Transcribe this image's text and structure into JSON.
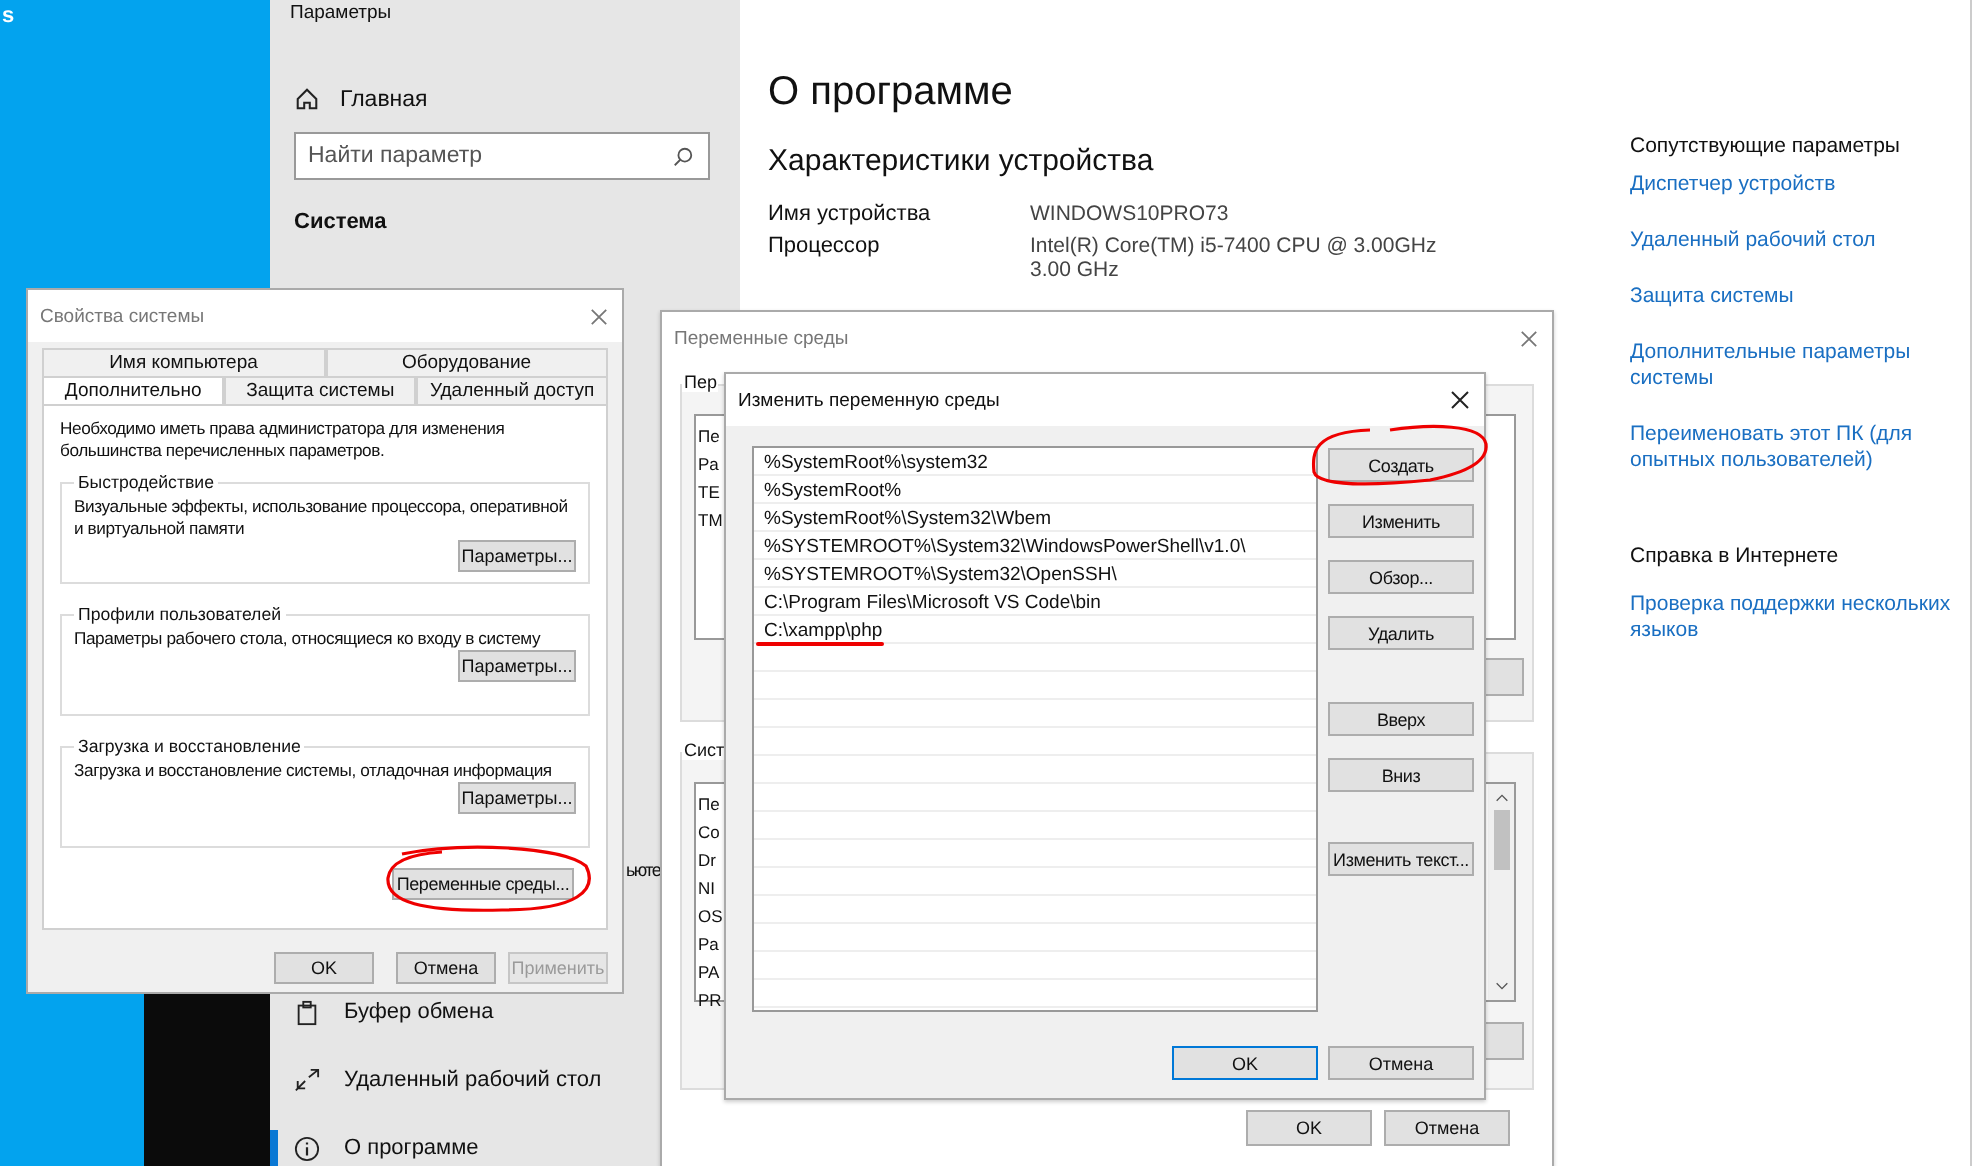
{
  "desktop": {
    "edge_text": "s"
  },
  "settings": {
    "title": "Параметры",
    "home": "Главная",
    "search": {
      "placeholder": "Найти параметр"
    },
    "section": "Система",
    "nav_peek": "ьюте",
    "nav": [
      {
        "label": "Буфер обмена",
        "kind": "clipboard",
        "selected": false
      },
      {
        "label": "Удаленный рабочий стол",
        "kind": "remote",
        "selected": false
      },
      {
        "label": "О программе",
        "kind": "info",
        "selected": true
      }
    ],
    "heading": "О программе",
    "subheading": "Характеристики устройства",
    "specs": [
      {
        "label": "Имя устройства",
        "lines": [
          "WINDOWS10PRO73"
        ]
      },
      {
        "label": "Процессор",
        "lines": [
          "Intel(R) Core(TM) i5-7400 CPU @ 3.00GHz",
          "3.00 GHz"
        ]
      }
    ],
    "related": {
      "title": "Сопутствующие параметры",
      "links": [
        {
          "lines": [
            "Диспетчер устройств"
          ]
        },
        {
          "lines": [
            "Удаленный рабочий стол"
          ]
        },
        {
          "lines": [
            "Защита системы"
          ]
        },
        {
          "lines": [
            "Дополнительные параметры",
            "системы"
          ]
        },
        {
          "lines": [
            "Переименовать этот ПК (для",
            "опытных пользователей)"
          ]
        }
      ]
    },
    "help": {
      "title": "Справка в Интернете",
      "links": [
        {
          "lines": [
            "Проверка поддержки нескольких",
            "языков"
          ]
        }
      ]
    }
  },
  "sysprops": {
    "title": "Свойства системы",
    "tab_rows": [
      [
        {
          "label": "Имя компьютера",
          "selected": false
        },
        {
          "label": "Оборудование",
          "selected": false
        }
      ],
      [
        {
          "label": "Дополнительно",
          "selected": true
        },
        {
          "label": "Защита системы",
          "selected": false
        },
        {
          "label": "Удаленный доступ",
          "selected": false
        }
      ]
    ],
    "note": "Необходимо иметь права администратора для изменения большинства перечисленных параметров.",
    "groups": [
      {
        "title": "Быстродействие",
        "text": "Визуальные эффекты, использование процессора, оперативной и виртуальной памяти",
        "button": "Параметры..."
      },
      {
        "title": "Профили пользователей",
        "text": "Параметры рабочего стола, относящиеся ко входу в систему",
        "button": "Параметры..."
      },
      {
        "title": "Загрузка и восстановление",
        "text": "Загрузка и восстановление системы, отладочная информация",
        "button": "Параметры..."
      }
    ],
    "env_button": {
      "label": "Переменные среды...",
      "circled": true
    },
    "buttons": [
      {
        "label": "OK",
        "disabled": false
      },
      {
        "label": "Отмена",
        "disabled": false
      },
      {
        "label": "Применить",
        "disabled": true
      }
    ]
  },
  "envvars": {
    "title": "Переменные среды",
    "user_group": "Пер",
    "user_rows": [
      "Пе",
      "Pa",
      "TE",
      "TM"
    ],
    "system_group": "Сист",
    "system_rows": [
      "Пе",
      "Co",
      "Dr",
      "NI",
      "OS",
      "Pa",
      "PA",
      "PR"
    ],
    "buttons": [
      "OK",
      "Отмена"
    ]
  },
  "edit": {
    "title": "Изменить переменную среды",
    "entries": [
      {
        "text": "%SystemRoot%\\system32",
        "underlined": false
      },
      {
        "text": "%SystemRoot%",
        "underlined": false
      },
      {
        "text": "%SystemRoot%\\System32\\Wbem",
        "underlined": false
      },
      {
        "text": "%SYSTEMROOT%\\System32\\WindowsPowerShell\\v1.0\\",
        "underlined": false
      },
      {
        "text": "%SYSTEMROOT%\\System32\\OpenSSH\\",
        "underlined": false
      },
      {
        "text": "C:\\Program Files\\Microsoft VS Code\\bin",
        "underlined": false
      },
      {
        "text": "C:\\xampp\\php",
        "underlined": true
      }
    ],
    "side_buttons": [
      {
        "label": "Создать",
        "circled": true
      },
      {
        "label": "Изменить",
        "circled": false
      },
      {
        "label": "Обзор...",
        "circled": false
      },
      {
        "label": "Удалить",
        "circled": false
      },
      {
        "label": "Вверх",
        "circled": false
      },
      {
        "label": "Вниз",
        "circled": false
      },
      {
        "label": "Изменить текст...",
        "circled": false
      }
    ],
    "buttons": [
      {
        "label": "OK",
        "default": true
      },
      {
        "label": "Отмена",
        "default": false
      }
    ]
  }
}
